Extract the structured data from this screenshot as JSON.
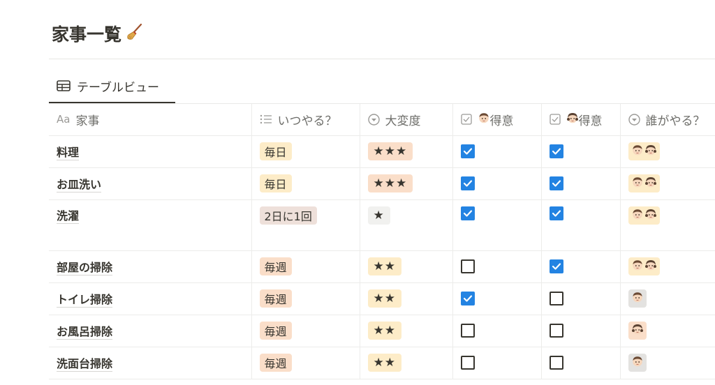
{
  "page": {
    "title": "家事一覧",
    "title_icon": "broom-emoji"
  },
  "view_tab": {
    "label": "テーブルビュー",
    "icon": "table-icon"
  },
  "columns": {
    "name": {
      "prefix": "Aa",
      "label": "家事"
    },
    "when": {
      "label": "いつやる？",
      "icon": "list-icon"
    },
    "difficulty": {
      "label": "大変度",
      "icon": "select-icon"
    },
    "good_boy": {
      "label": "得意",
      "icon": "checkbox-icon",
      "person": "boy-face"
    },
    "good_girl": {
      "label": "得意",
      "icon": "checkbox-icon",
      "person": "girl-face"
    },
    "who": {
      "label": "誰がやる？",
      "icon": "select-icon"
    }
  },
  "colors": {
    "tag_daily": "#fdecc8",
    "tag_weekly": "#fadec9",
    "tag_twodays": "#eee0da",
    "stars_3": "#fadec9",
    "stars_2": "#fdecc8",
    "stars_1": "#f1f1ef",
    "who_both": "#fdecc8",
    "who_boy": "#e3e2e0",
    "who_girl": "#fadec9",
    "checkbox_on": "#2383e2"
  },
  "rows": [
    {
      "name": "料理",
      "when": "毎日",
      "when_color": "daily",
      "stars": "★★★",
      "stars_color": "3",
      "good_boy": true,
      "good_girl": true,
      "who": [
        "boy-face",
        "girl-face"
      ],
      "who_color": "both",
      "tall": false
    },
    {
      "name": "お皿洗い",
      "when": "毎日",
      "when_color": "daily",
      "stars": "★★★",
      "stars_color": "3",
      "good_boy": true,
      "good_girl": true,
      "who": [
        "boy-face",
        "girl-face"
      ],
      "who_color": "both",
      "tall": false
    },
    {
      "name": "洗濯",
      "when": "2日に1回",
      "when_color": "twodays",
      "stars": "★",
      "stars_color": "1",
      "good_boy": true,
      "good_girl": true,
      "who": [
        "boy-face",
        "girl-face"
      ],
      "who_color": "both",
      "tall": true
    },
    {
      "name": "部屋の掃除",
      "when": "毎週",
      "when_color": "weekly",
      "stars": "★★",
      "stars_color": "2",
      "good_boy": false,
      "good_girl": true,
      "who": [
        "boy-face",
        "girl-face"
      ],
      "who_color": "both",
      "tall": false
    },
    {
      "name": "トイレ掃除",
      "when": "毎週",
      "when_color": "weekly",
      "stars": "★★",
      "stars_color": "2",
      "good_boy": true,
      "good_girl": false,
      "who": [
        "boy-face"
      ],
      "who_color": "boy",
      "tall": false
    },
    {
      "name": "お風呂掃除",
      "when": "毎週",
      "when_color": "weekly",
      "stars": "★★",
      "stars_color": "2",
      "good_boy": false,
      "good_girl": false,
      "who": [
        "girl-face"
      ],
      "who_color": "girl",
      "tall": false
    },
    {
      "name": "洗面台掃除",
      "when": "毎週",
      "when_color": "weekly",
      "stars": "★★",
      "stars_color": "2",
      "good_boy": false,
      "good_girl": false,
      "who": [
        "boy-face"
      ],
      "who_color": "boy",
      "tall": false
    }
  ]
}
